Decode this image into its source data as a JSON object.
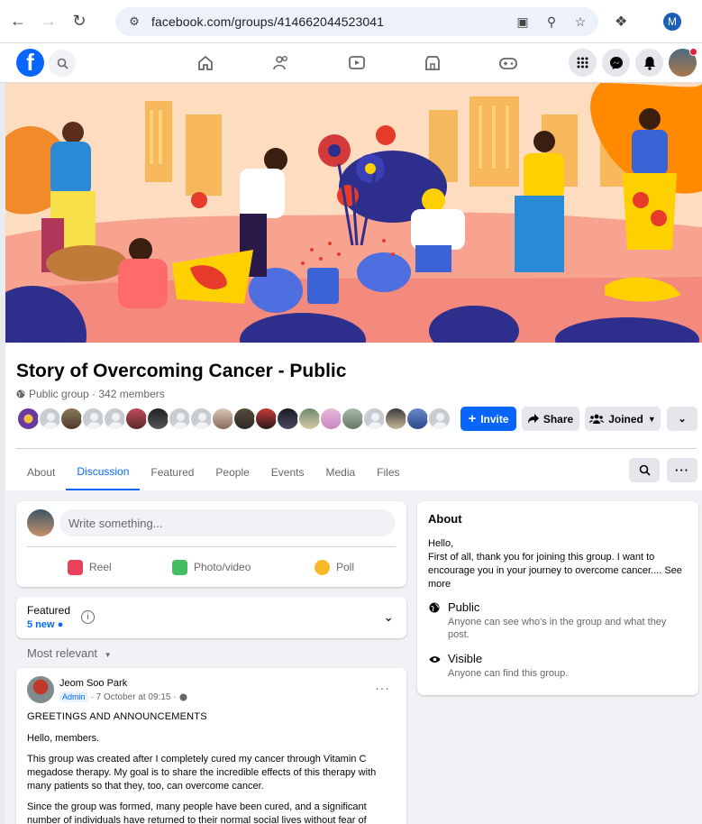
{
  "browser": {
    "url": "facebook.com/groups/414662044523041",
    "profile_initial": "M"
  },
  "group": {
    "title": "Story of Overcoming Cancer - Public",
    "meta": "Public group · 342 members",
    "buttons": {
      "invite": "Invite",
      "share": "Share",
      "joined": "Joined"
    }
  },
  "tabs": [
    "About",
    "Discussion",
    "Featured",
    "People",
    "Events",
    "Media",
    "Files"
  ],
  "composer": {
    "placeholder": "Write something...",
    "actions": {
      "reel": "Reel",
      "photo": "Photo/video",
      "poll": "Poll"
    }
  },
  "featured": {
    "title": "Featured",
    "new": "5 new"
  },
  "sort_label": "Most relevant",
  "post": {
    "author": "Jeom Soo Park",
    "badge": "Admin",
    "time": "· 7 October at 09:15 ·",
    "heading": "GREETINGS AND ANNOUNCEMENTS",
    "p1": "Hello, members.",
    "p2": "This group was created after I completely cured my cancer through Vitamin C megadose therapy. My goal is to share the incredible effects of this therapy with many patients so that they, too, can overcome cancer.",
    "p3": "Since the group was formed, many people have been cured, and a significant number of individuals have returned to their normal social lives without fear of"
  },
  "about": {
    "title": "About",
    "hello": "Hello,",
    "text": "First of all, thank you for joining this group. I want to encourage you in your journey to overcome cancer.... See more",
    "public_title": "Public",
    "public_desc": "Anyone can see who's in the group and what they post.",
    "visible_title": "Visible",
    "visible_desc": "Anyone can find this group."
  },
  "colors": {
    "accent": "#0866ff",
    "cover_bg": "#fdd9b5"
  }
}
